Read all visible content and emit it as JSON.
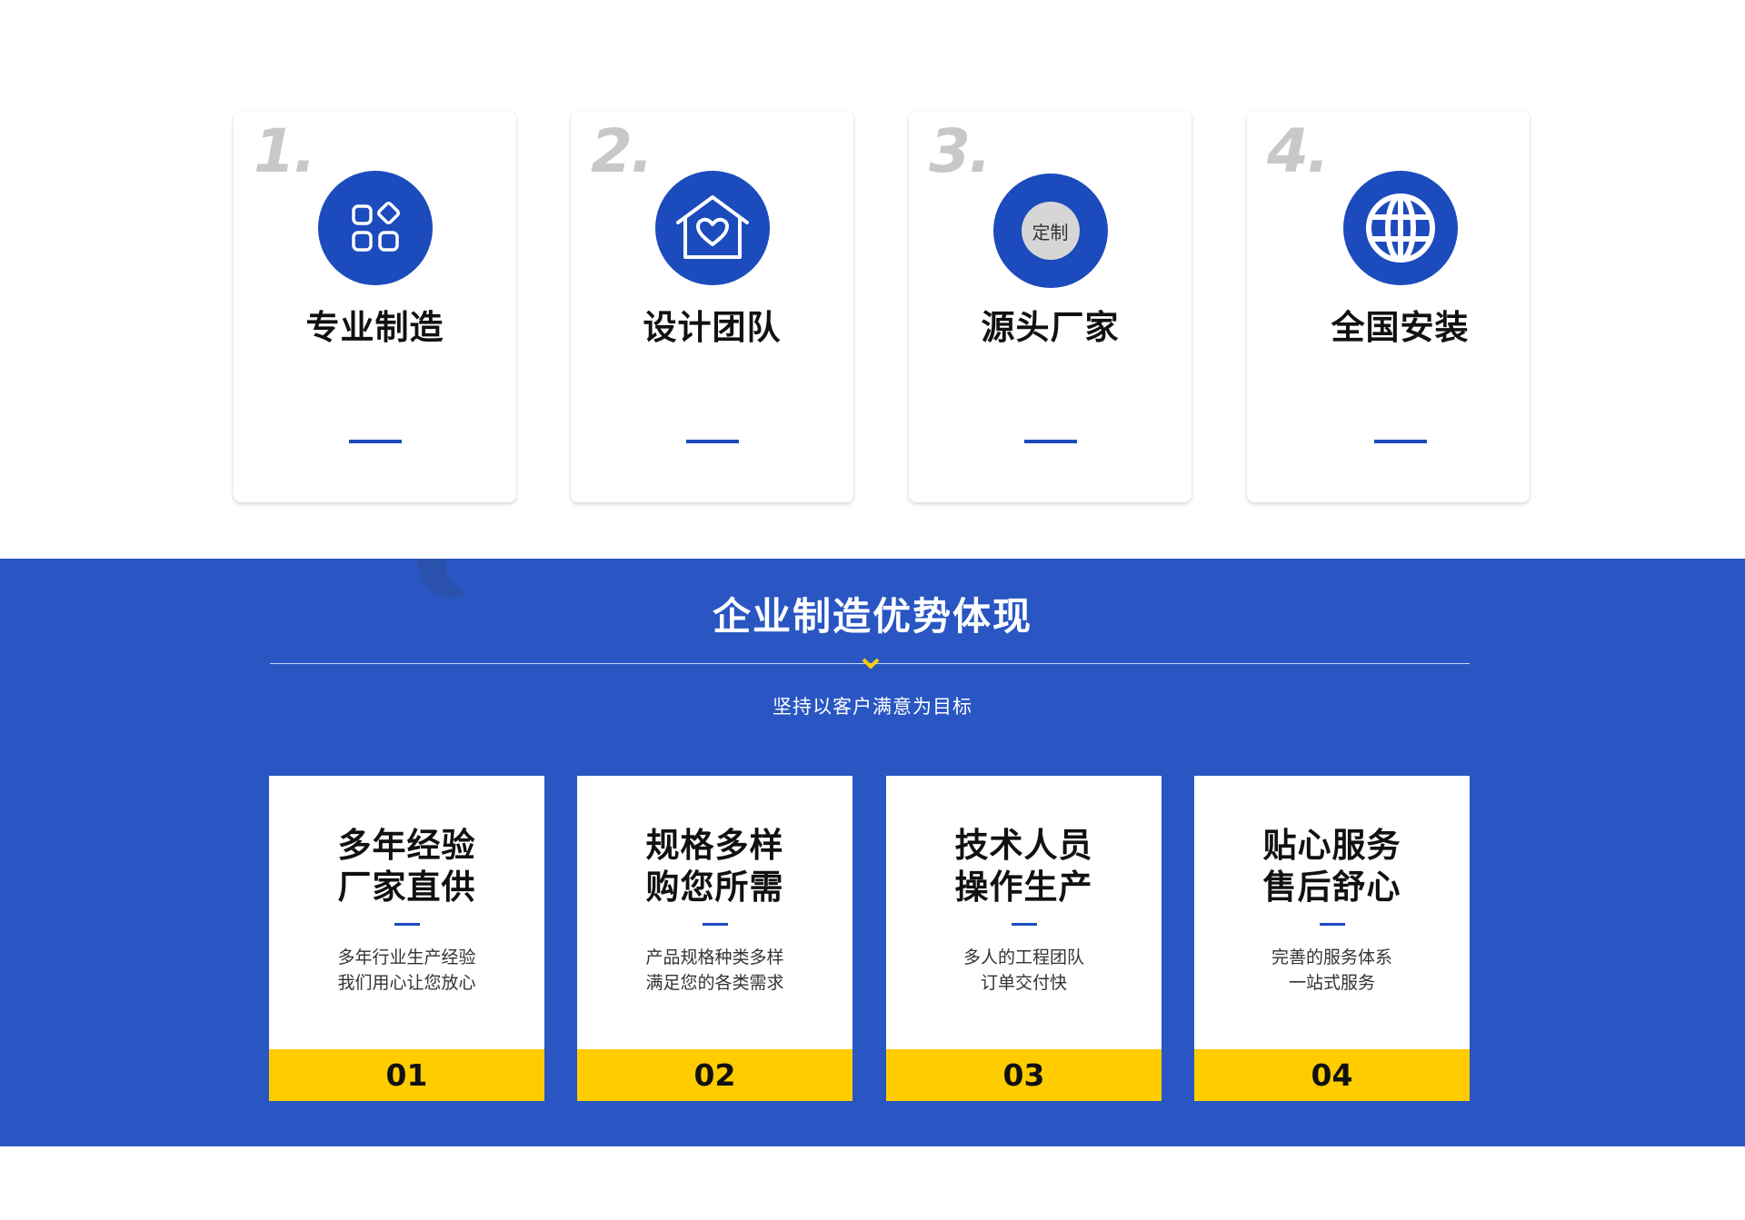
{
  "colors": {
    "brand_blue": "#1b4bbd",
    "section_blue": "#2956c2",
    "accent_yellow": "#ffcc00",
    "number_gray": "#c8c8c8"
  },
  "features": [
    {
      "number": "1.",
      "title": "专业制造",
      "icon": "apps-grid-icon"
    },
    {
      "number": "2.",
      "title": "设计团队",
      "icon": "house-heart-icon"
    },
    {
      "number": "3.",
      "title": "源头厂家",
      "icon": "custom-badge-icon",
      "badge_text": "定制"
    },
    {
      "number": "4.",
      "title": "全国安装",
      "icon": "globe-icon"
    }
  ],
  "section": {
    "title": "企业制造优势体现",
    "subtitle": "坚持以客户满意为目标"
  },
  "advantages": [
    {
      "title_line1": "多年经验",
      "title_line2": "厂家直供",
      "desc_line1": "多年行业生产经验",
      "desc_line2": "我们用心让您放心",
      "number": "01"
    },
    {
      "title_line1": "规格多样",
      "title_line2": "购您所需",
      "desc_line1": "产品规格种类多样",
      "desc_line2": "满足您的各类需求",
      "number": "02"
    },
    {
      "title_line1": "技术人员",
      "title_line2": "操作生产",
      "desc_line1": "多人的工程团队",
      "desc_line2": "订单交付快",
      "number": "03"
    },
    {
      "title_line1": "贴心服务",
      "title_line2": "售后舒心",
      "desc_line1": "完善的服务体系",
      "desc_line2": "一站式服务",
      "number": "04"
    }
  ]
}
